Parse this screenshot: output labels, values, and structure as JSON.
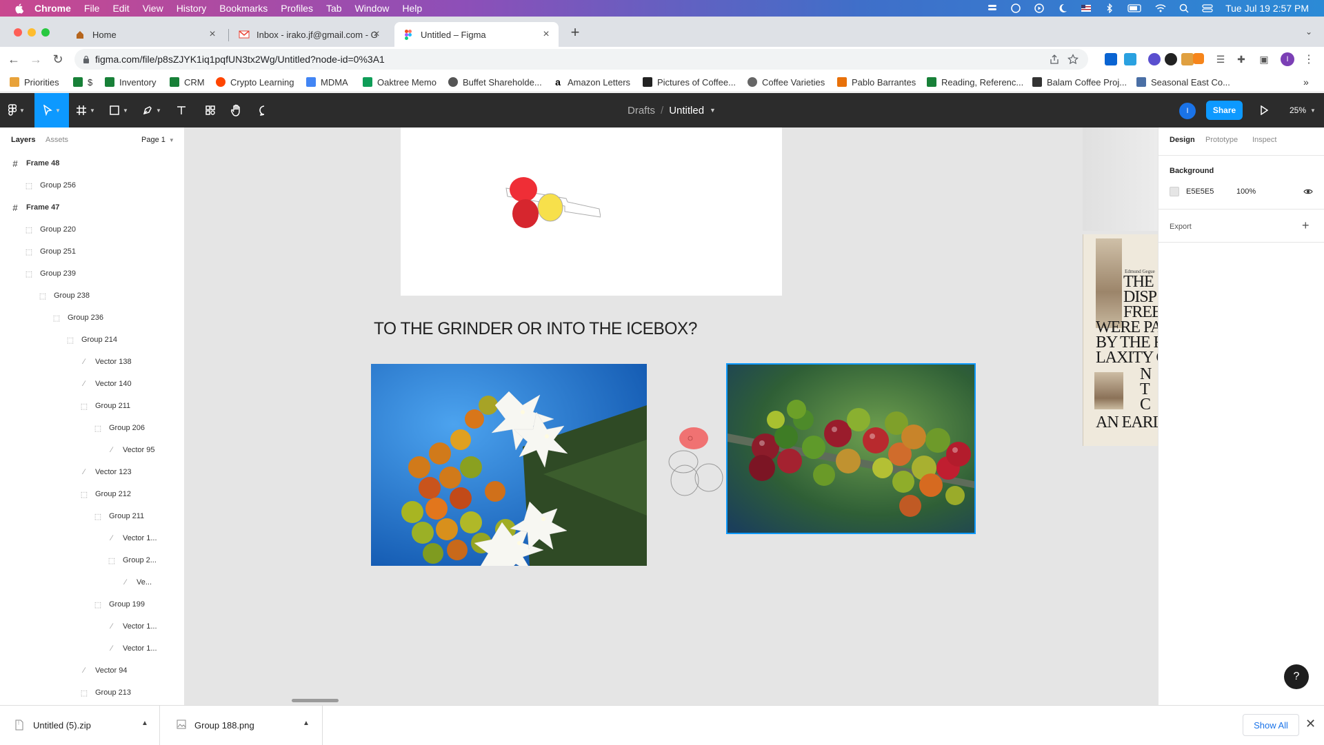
{
  "menubar": {
    "app": "Chrome",
    "items": [
      "File",
      "Edit",
      "View",
      "History",
      "Bookmarks",
      "Profiles",
      "Tab",
      "Window",
      "Help"
    ],
    "datetime": "Tue Jul 19  2:57 PM"
  },
  "tabs": [
    {
      "title": "Home",
      "icon": "figma-home-icon"
    },
    {
      "title": "Inbox - irako.jf@gmail.com - G",
      "icon": "gmail-icon"
    },
    {
      "title": "Untitled – Figma",
      "icon": "figma-icon"
    }
  ],
  "address": {
    "url": "figma.com/file/p8sZJYK1iq1pqfUN3tx2Wg/Untitled?node-id=0%3A1"
  },
  "bookmarks": [
    {
      "label": "Priorities",
      "color": "#e8a23a"
    },
    {
      "label": "$",
      "color": "#188038"
    },
    {
      "label": "Inventory",
      "color": "#188038"
    },
    {
      "label": "CRM",
      "color": "#188038"
    },
    {
      "label": "Crypto Learning",
      "color": "#ff4500"
    },
    {
      "label": "MDMA",
      "color": "#4285f4"
    },
    {
      "label": "Oaktree Memo",
      "color": "#0f9d58"
    },
    {
      "label": "Buffet Shareholde...",
      "color": "#555555"
    },
    {
      "label": "Amazon Letters",
      "color": "#000000"
    },
    {
      "label": "Pictures of Coffee...",
      "color": "#222222"
    },
    {
      "label": "Coffee Varieties",
      "color": "#666666"
    },
    {
      "label": "Pablo Barrantes",
      "color": "#e8710a"
    },
    {
      "label": "Reading, Referenc...",
      "color": "#188038"
    },
    {
      "label": "Balam Coffee Proj...",
      "color": "#333333"
    },
    {
      "label": "Seasonal East Co...",
      "color": "#4a6fa5"
    }
  ],
  "figma": {
    "breadcrumb_parent": "Drafts",
    "breadcrumb_sep": "/",
    "file_name": "Untitled",
    "share": "Share",
    "avatar": "I",
    "zoom": "25%"
  },
  "layers_panel": {
    "tab_layers": "Layers",
    "tab_assets": "Assets",
    "page": "Page 1",
    "rows": [
      {
        "name": "Frame 48",
        "icon": "frame-icon",
        "level": 0,
        "bold": true
      },
      {
        "name": "Group 256",
        "icon": "group-icon",
        "level": 1
      },
      {
        "name": "Frame 47",
        "icon": "frame-icon",
        "level": 0,
        "bold": true
      },
      {
        "name": "Group 220",
        "icon": "group-icon",
        "level": 1
      },
      {
        "name": "Group 251",
        "icon": "group-icon",
        "level": 1
      },
      {
        "name": "Group 239",
        "icon": "group-icon",
        "level": 1
      },
      {
        "name": "Group 238",
        "icon": "group-icon",
        "level": 2
      },
      {
        "name": "Group 236",
        "icon": "group-icon",
        "level": 3
      },
      {
        "name": "Group 214",
        "icon": "group-icon",
        "level": 4
      },
      {
        "name": "Vector 138",
        "icon": "vector-icon",
        "level": 5
      },
      {
        "name": "Vector 140",
        "icon": "vector-icon",
        "level": 5
      },
      {
        "name": "Group 211",
        "icon": "group-icon",
        "level": 5
      },
      {
        "name": "Group 206",
        "icon": "group-icon",
        "level": 6
      },
      {
        "name": "Vector 95",
        "icon": "vector-icon",
        "level": 7
      },
      {
        "name": "Vector 123",
        "icon": "vector-icon",
        "level": 5
      },
      {
        "name": "Group 212",
        "icon": "group-icon",
        "level": 5
      },
      {
        "name": "Group 211",
        "icon": "group-icon",
        "level": 6
      },
      {
        "name": "Vector 1...",
        "icon": "vector-icon",
        "level": 7
      },
      {
        "name": "Group 2...",
        "icon": "group-icon",
        "level": 7
      },
      {
        "name": "Ve...",
        "icon": "vector-icon",
        "level": 8
      },
      {
        "name": "Group 199",
        "icon": "group-icon",
        "level": 6
      },
      {
        "name": "Vector 1...",
        "icon": "vector-icon",
        "level": 7
      },
      {
        "name": "Vector 1...",
        "icon": "vector-icon",
        "level": 7
      },
      {
        "name": "Vector 94",
        "icon": "vector-icon",
        "level": 5
      },
      {
        "name": "Group 213",
        "icon": "group-icon",
        "level": 5
      }
    ]
  },
  "canvas": {
    "headline": "TO THE GRINDER OR INTO THE ICEBOX?",
    "clipping": {
      "author": "Edmund Gegue",
      "lines": [
        "THE",
        "DISP",
        "FREE",
        "WERE PA",
        "BY THE R",
        "LAXITY C",
        "N",
        "T",
        "C",
        "AN EARL"
      ]
    }
  },
  "right_panel": {
    "tabs": [
      "Design",
      "Prototype",
      "Inspect"
    ],
    "background_label": "Background",
    "background_hex": "E5E5E5",
    "background_opacity": "100%",
    "export_label": "Export"
  },
  "downloads": {
    "items": [
      {
        "name": "Untitled (5).zip"
      },
      {
        "name": "Group 188.png"
      }
    ],
    "show_all": "Show All"
  },
  "help": "?"
}
